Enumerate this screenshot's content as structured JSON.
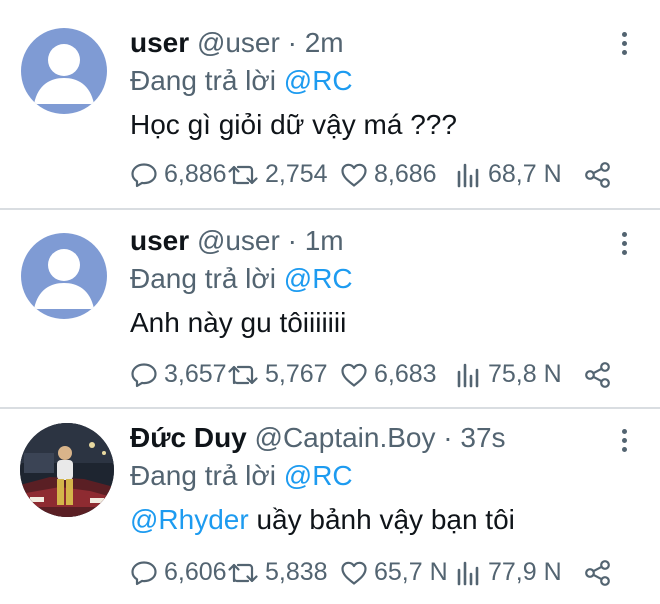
{
  "tweets": [
    {
      "name": "user",
      "handle": "@user",
      "time": "· 2m",
      "reply_prefix": "Đang trả lời",
      "reply_to": "@RC",
      "text": "Học gì giỏi dữ vậy má ???",
      "text_mention": "",
      "avatar": "default-avatar",
      "replies": "6,886",
      "retweets": "2,754",
      "likes": "8,686",
      "views": "68,7 N"
    },
    {
      "name": "user",
      "handle": "@user",
      "time": "· 1m",
      "reply_prefix": "Đang trả lời",
      "reply_to": "@RC",
      "text": "Anh này gu tôiiiiiii",
      "text_mention": "",
      "avatar": "default-avatar",
      "replies": "3,657",
      "retweets": "5,767",
      "likes": "6,683",
      "views": "75,8 N"
    },
    {
      "name": "Đức Duy",
      "handle": "@Captain.Boy",
      "time": "· 37s",
      "reply_prefix": "Đang trả lời",
      "reply_to": "@RC",
      "text": "uầy bảnh vậy bạn tôi",
      "text_mention": "@Rhyder",
      "avatar": "photo-avatar",
      "replies": "6,606",
      "retweets": "5,838",
      "likes": "65,7 N",
      "views": "77,9 N"
    }
  ],
  "colors": {
    "accent": "#1d9bf0",
    "muted": "#536471",
    "text": "#0f1419",
    "divider": "#d9dde1",
    "default_avatar": "#7f9bd4"
  },
  "icons": [
    "reply-icon",
    "retweet-icon",
    "like-icon",
    "views-icon",
    "share-icon",
    "more-icon"
  ]
}
